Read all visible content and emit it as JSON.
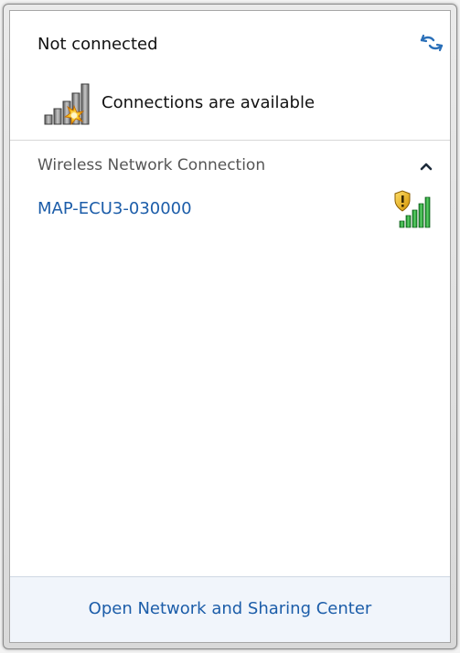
{
  "header": {
    "status_title": "Not connected",
    "status_message": "Connections are available",
    "refresh_icon": "refresh-arrows-icon"
  },
  "section": {
    "title": "Wireless Network Connection",
    "toggle_icon": "chevron-up-icon"
  },
  "networks": [
    {
      "name": "MAP-ECU3-030000",
      "secured": true,
      "signal_bars": 5,
      "signal_icon": "wifi-signal-icon"
    }
  ],
  "footer": {
    "link_label": "Open Network and Sharing Center"
  },
  "colors": {
    "accent": "#1c5da9",
    "muted_text": "#555555",
    "signal_green": "#22a531",
    "warning_amber": "#f0b400"
  }
}
